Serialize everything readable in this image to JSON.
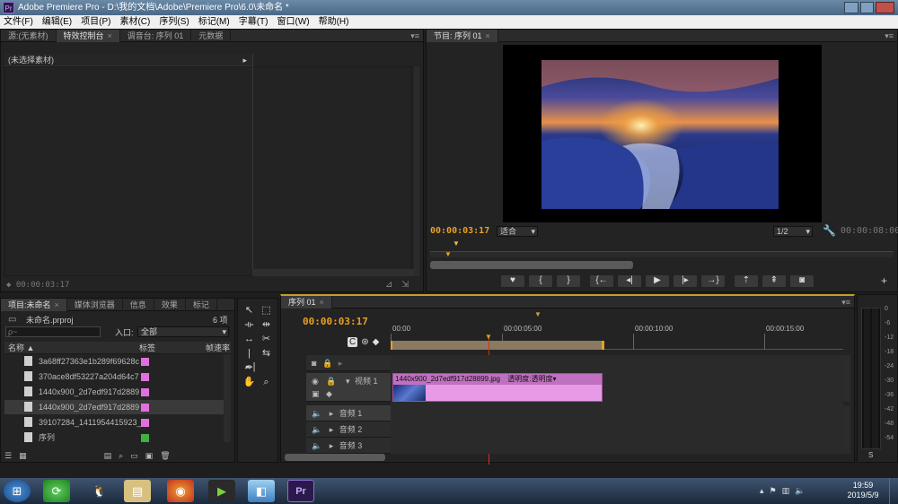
{
  "window": {
    "title": "Adobe Premiere Pro - D:\\我的文档\\Adobe\\Premiere Pro\\6.0\\未命名 *",
    "app_icon": "Pr"
  },
  "menu": [
    "文件(F)",
    "编辑(E)",
    "项目(P)",
    "素材(C)",
    "序列(S)",
    "标记(M)",
    "字幕(T)",
    "窗口(W)",
    "帮助(H)"
  ],
  "source_panel": {
    "tabs": [
      "源:(无素材)",
      "特效控制台",
      "调音台: 序列 01",
      "元数据"
    ],
    "no_clip": "(未选择素材)",
    "timecode": "00:00:03:17"
  },
  "program_monitor": {
    "tab": "节目: 序列 01",
    "timecode": "00:00:03:17",
    "fit": "适合",
    "resolution": "1/2",
    "duration": "00:00:08:00"
  },
  "project_panel": {
    "tabs": [
      "项目:未命名",
      "媒体浏览器",
      "信息",
      "效果",
      "标记"
    ],
    "project_file": "未命名.prproj",
    "item_count": "6 项",
    "search_placeholder": "ρ~",
    "entry_label": "入口:",
    "entry_value": "全部",
    "columns": [
      "名称",
      "标签",
      "帧速率"
    ],
    "files": [
      "3a68ff27363e1b289f69628c",
      "370ace8df53227a204d64c7",
      "1440x900_2d7edf917d2889",
      "1440x900_2d7edf917d2889",
      "39107284_1411954415923_",
      "序列"
    ],
    "label_color": "#e070e0"
  },
  "timeline": {
    "tab": "序列 01",
    "timecode": "00:00:03:17",
    "ruler": [
      "00:00",
      "00:00:05:00",
      "00:00:10:00",
      "00:00:15:00"
    ],
    "tracks": {
      "video": "视频 1",
      "audio1": "音频 1",
      "audio2": "音频 2",
      "audio3": "音频 3"
    },
    "clip_label": "1440x900_2d7edf917d28899.jpg",
    "clip_opacity": "透明度:透明度",
    "clip_color": "#e79ae5"
  },
  "vu_meter": {
    "scale": [
      "0",
      "-6",
      "-12",
      "-18",
      "-24",
      "-30",
      "-36",
      "-42",
      "-48",
      "-54"
    ],
    "solo": "S"
  },
  "taskbar": {
    "time": "19:59",
    "date": "2019/5/9",
    "pinned_app": "Pr"
  }
}
